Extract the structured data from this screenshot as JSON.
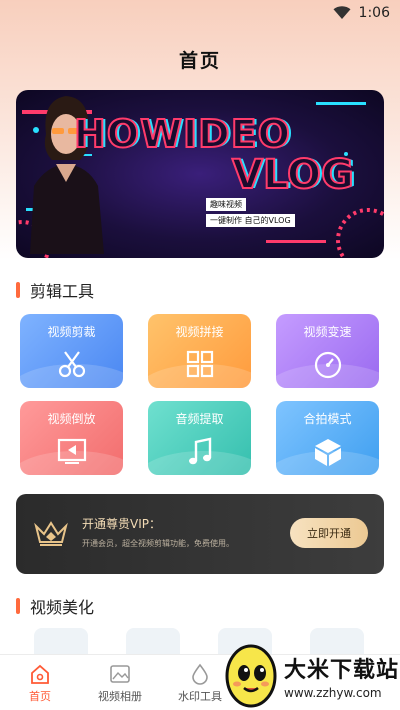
{
  "status_bar": {
    "time": "1:06"
  },
  "header": {
    "title": "首页"
  },
  "banner": {
    "headline": "HOWIDEO",
    "subheadline": "VLOG",
    "tag1": "趣味视频",
    "tag2": "一键制作 自己的VLOG"
  },
  "tools_section": {
    "title": "剪辑工具",
    "items": [
      {
        "label": "视频剪裁",
        "icon": "scissors-icon",
        "color_from": "#7fb3ff",
        "color_to": "#4a87f2"
      },
      {
        "label": "视频拼接",
        "icon": "grid-icon",
        "color_from": "#ffc36b",
        "color_to": "#ff9b3d"
      },
      {
        "label": "视频变速",
        "icon": "speed-dial-icon",
        "color_from": "#c59cff",
        "color_to": "#9a6af0"
      },
      {
        "label": "视频倒放",
        "icon": "reverse-play-icon",
        "color_from": "#ff9a9a",
        "color_to": "#f26d6d"
      },
      {
        "label": "音频提取",
        "icon": "music-note-icon",
        "color_from": "#6fe0cf",
        "color_to": "#35bfae"
      },
      {
        "label": "合拍模式",
        "icon": "cube-icon",
        "color_from": "#7fc4ff",
        "color_to": "#3f9ff0"
      }
    ]
  },
  "vip": {
    "title": "开通尊贵VIP：",
    "description": "开通会员，超全视频剪辑功能，免费使用。",
    "button_label": "立即开通"
  },
  "beauty_section": {
    "title": "视频美化"
  },
  "bottom_nav": {
    "items": [
      {
        "label": "首页",
        "icon": "home-icon",
        "active": true
      },
      {
        "label": "视频相册",
        "icon": "album-icon",
        "active": false
      },
      {
        "label": "水印工具",
        "icon": "watermark-icon",
        "active": false
      }
    ]
  },
  "watermark": {
    "name": "大米下载站",
    "url": "www.zzhyw.com"
  }
}
